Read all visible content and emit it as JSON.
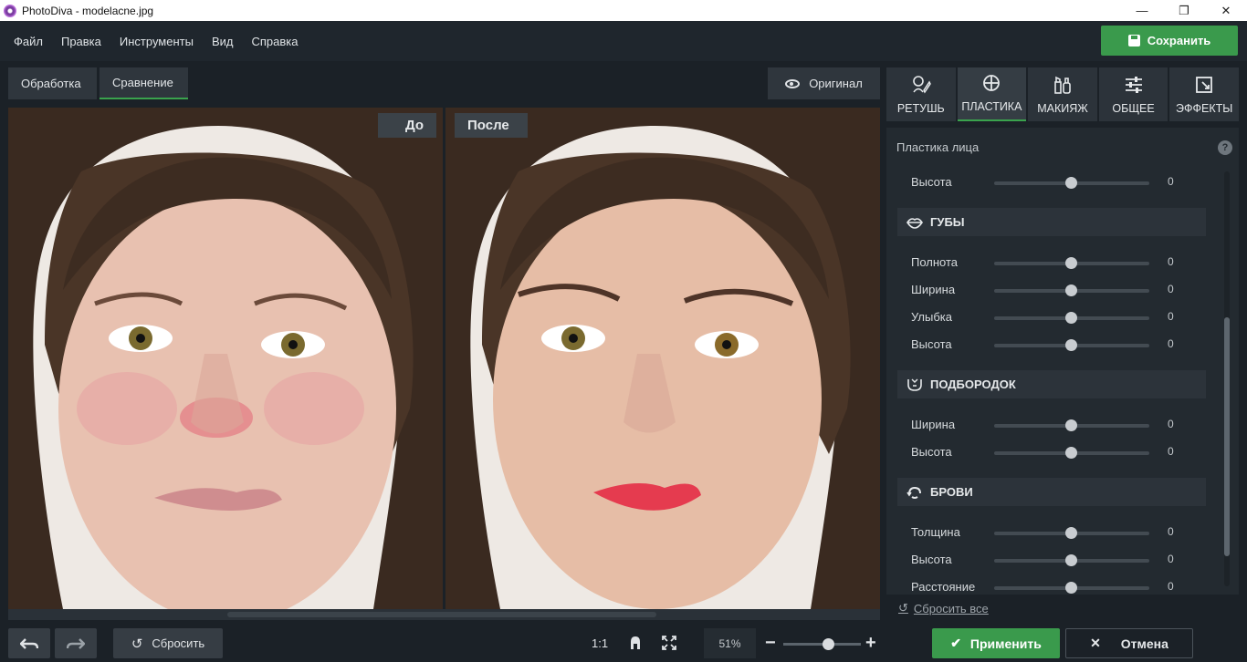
{
  "window": {
    "title": "PhotoDiva - modelacne.jpg",
    "controls": [
      "—",
      "❐",
      "✕"
    ]
  },
  "menu": {
    "items": [
      "Файл",
      "Правка",
      "Инструменты",
      "Вид",
      "Справка"
    ],
    "save_label": "Сохранить"
  },
  "view_tabs": {
    "processing": "Обработка",
    "compare": "Сравнение",
    "original": "Оригинал"
  },
  "compare": {
    "before_label": "До",
    "after_label": "После"
  },
  "bottom_bar": {
    "undo_icon": "undo-icon",
    "redo_icon": "redo-icon",
    "reset_label": "Сбросить",
    "ratio_label": "1:1",
    "zoom_value": "51%",
    "zoom_minus": "−",
    "zoom_plus": "+",
    "zoom_level_fraction": 0.5
  },
  "tool_tabs": [
    {
      "label": "РЕТУШЬ",
      "icon": "retouch-icon"
    },
    {
      "label": "ПЛАСТИКА",
      "icon": "reshape-icon",
      "active": true
    },
    {
      "label": "МАКИЯЖ",
      "icon": "makeup-icon"
    },
    {
      "label": "ОБЩЕЕ",
      "icon": "sliders-icon"
    },
    {
      "label": "ЭФФЕКТЫ",
      "icon": "effects-icon"
    }
  ],
  "panel": {
    "title": "Пластика лица",
    "help": "?",
    "top_slider": {
      "label": "Высота",
      "value": "0"
    },
    "sections": {
      "lips": {
        "title": "ГУБЫ",
        "sliders": [
          {
            "label": "Полнота",
            "value": "0"
          },
          {
            "label": "Ширина",
            "value": "0"
          },
          {
            "label": "Улыбка",
            "value": "0"
          },
          {
            "label": "Высота",
            "value": "0"
          }
        ]
      },
      "chin": {
        "title": "ПОДБОРОДОК",
        "sliders": [
          {
            "label": "Ширина",
            "value": "0"
          },
          {
            "label": "Высота",
            "value": "0"
          }
        ]
      },
      "brows": {
        "title": "БРОВИ",
        "sliders": [
          {
            "label": "Толщина",
            "value": "0"
          },
          {
            "label": "Высота",
            "value": "0"
          },
          {
            "label": "Расстояние",
            "value": "0"
          }
        ]
      }
    },
    "reset_all": "Сбросить все"
  },
  "actions": {
    "apply": "Применить",
    "cancel": "Отмена"
  },
  "colors": {
    "accent_green": "#3a9a4c",
    "background": "#1b2127",
    "panel": "#232a30"
  }
}
